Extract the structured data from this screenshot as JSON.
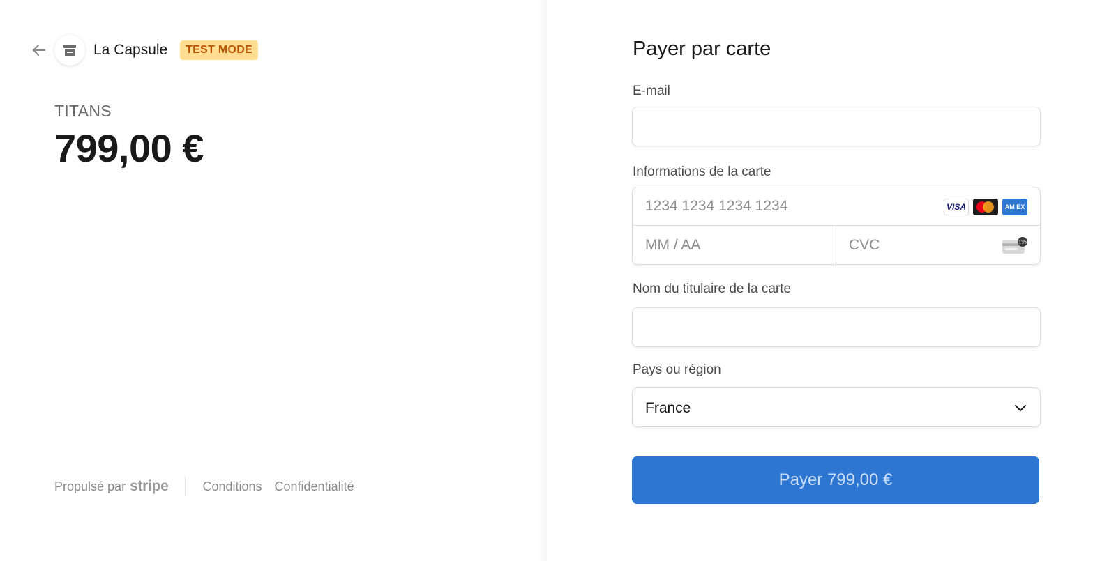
{
  "merchant": {
    "name": "La Capsule",
    "badge": "TEST MODE"
  },
  "product": {
    "name": "TITANS",
    "price": "799,00 €"
  },
  "footer": {
    "powered_by": "Propulsé par",
    "brand": "stripe",
    "links": [
      "Conditions",
      "Confidentialité"
    ]
  },
  "form": {
    "title": "Payer par carte",
    "email": {
      "label": "E-mail",
      "value": "",
      "placeholder": ""
    },
    "card": {
      "label": "Informations de la carte",
      "number_placeholder": "1234 1234 1234 1234",
      "expiry_placeholder": "MM / AA",
      "cvc_placeholder": "CVC",
      "brands": [
        "visa-icon",
        "mastercard-icon",
        "amex-icon"
      ],
      "visa_text": "VISA",
      "amex_text": "AM EX",
      "cvc_icon_text": "135"
    },
    "cardholder": {
      "label": "Nom du titulaire de la carte",
      "value": "",
      "placeholder": ""
    },
    "country": {
      "label": "Pays ou région",
      "selected": "France"
    },
    "pay_button": "Payer 799,00 €"
  },
  "colors": {
    "accent": "#2d76d2",
    "badge_bg": "#ffde92",
    "badge_text": "#bb5504"
  }
}
